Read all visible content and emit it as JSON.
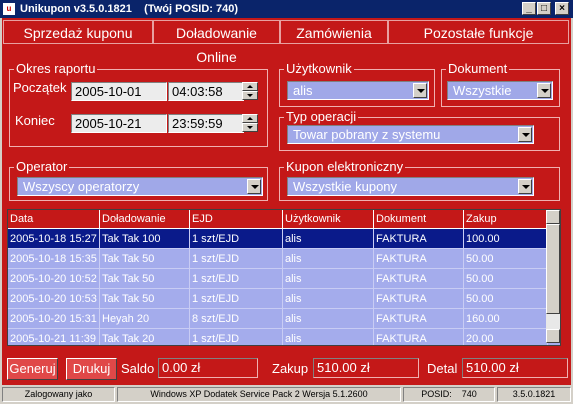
{
  "window": {
    "title": "Unikupon v3.5.0.1821",
    "posid_title": "(Twój POSID: 740)"
  },
  "menu": [
    "Sprzedaż kuponu",
    "Doładowanie Online",
    "Zamówienia",
    "Pozostałe funkcje"
  ],
  "report_period": {
    "label": "Okres raportu",
    "start_label": "Początek",
    "start_date": "2005-10-01",
    "start_time": "04:03:58",
    "end_label": "Koniec",
    "end_date": "2005-10-21",
    "end_time": "23:59:59"
  },
  "user": {
    "label": "Użytkownik",
    "value": "alis"
  },
  "document": {
    "label": "Dokument",
    "value": "Wszystkie"
  },
  "operation_type": {
    "label": "Typ operacji",
    "value": "Towar pobrany z systemu"
  },
  "operator": {
    "label": "Operator",
    "value": "Wszyscy operatorzy"
  },
  "e_coupon": {
    "label": "Kupon elektroniczny",
    "value": "Wszystkie kupony"
  },
  "table": {
    "columns": [
      "Data",
      "Doładowanie",
      "EJD",
      "Użytkownik",
      "Dokument",
      "Zakup"
    ],
    "rows": [
      [
        "2005-10-18 15:27",
        "Tak Tak 100",
        "1 szt/EJD",
        "alis",
        "FAKTURA",
        "100.00"
      ],
      [
        "2005-10-18 15:35",
        "Tak Tak 50",
        "1 szt/EJD",
        "alis",
        "FAKTURA",
        "50.00"
      ],
      [
        "2005-10-20 10:52",
        "Tak Tak 50",
        "1 szt/EJD",
        "alis",
        "FAKTURA",
        "50.00"
      ],
      [
        "2005-10-20 10:53",
        "Tak Tak 50",
        "1 szt/EJD",
        "alis",
        "FAKTURA",
        "50.00"
      ],
      [
        "2005-10-20 15:31",
        "Heyah 20",
        "8 szt/EJD",
        "alis",
        "FAKTURA",
        "160.00"
      ],
      [
        "2005-10-21 11:39",
        "Tak Tak 20",
        "1 szt/EJD",
        "alis",
        "FAKTURA",
        "20.00"
      ]
    ]
  },
  "actions": {
    "generate": "Generuj",
    "print": "Drukuj"
  },
  "totals": {
    "saldo_label": "Saldo",
    "saldo": "0.00 zł",
    "zakup_label": "Zakup",
    "zakup": "510.00 zł",
    "detal_label": "Detal",
    "detal": "510.00 zł"
  },
  "status": {
    "logged": "Zalogowany jako",
    "os": "Windows XP Dodatek Service Pack 2 Wersja 5.1.2600",
    "posid_label": "POSID:",
    "posid": "740",
    "version": "3.5.0.1821"
  },
  "colors": {
    "accent": "#c41818",
    "selection": "#0a1a8a",
    "combo": "#a0a8e8"
  }
}
